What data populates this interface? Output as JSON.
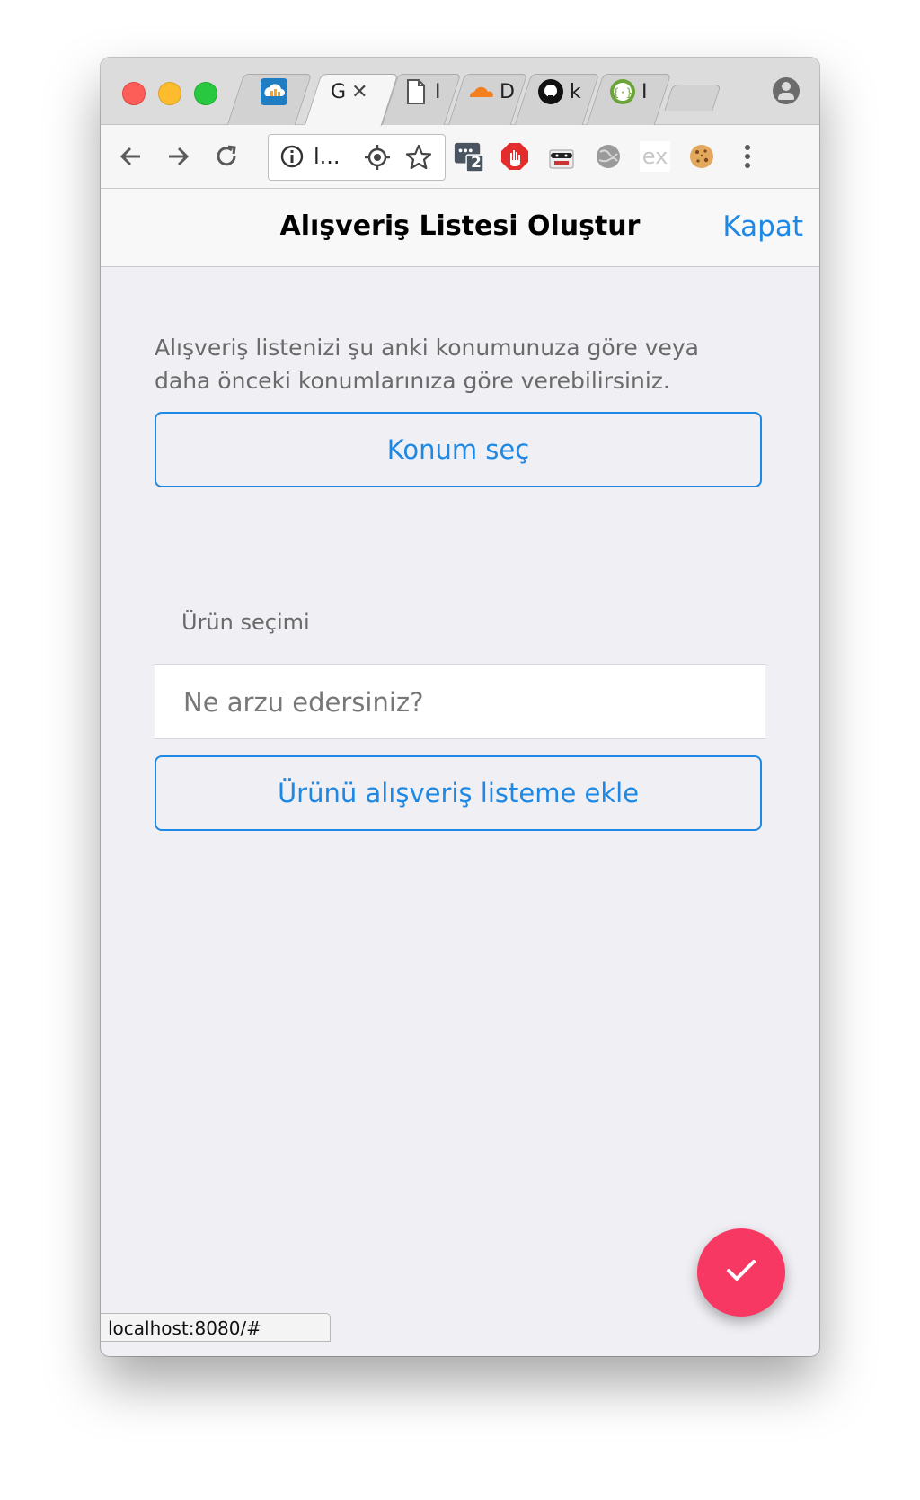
{
  "browser": {
    "active_tab_label": "G",
    "tabs": [
      {
        "label": "",
        "icon": "cloud-chart-icon"
      },
      {
        "label": "G",
        "icon": "",
        "active": true
      },
      {
        "label": "I",
        "icon": "document-icon"
      },
      {
        "label": "D",
        "icon": "cloudflare-icon"
      },
      {
        "label": "k",
        "icon": "github-icon"
      },
      {
        "label": "I",
        "icon": "json-icon"
      }
    ],
    "omnibox_text": "l...",
    "extension_badge": "2",
    "ex_label": "ex",
    "status_url": "localhost:8080/#"
  },
  "navbar": {
    "title": "Alışveriş Listesi Oluştur",
    "close_label": "Kapat"
  },
  "main": {
    "intro_text": "Alışveriş listenizi şu anki konumunuza göre veya daha önceki konumlarınıza göre verebilirsiniz.",
    "location_button": "Konum seç",
    "product_label": "Ürün seçimi",
    "product_placeholder": "Ne arzu edersiniz?",
    "add_button": "Ürünü alışveriş listeme ekle"
  },
  "fab": {
    "icon": "checkmark-icon"
  },
  "colors": {
    "accent": "#1e88e5",
    "fab": "#f73862",
    "background": "#efeff4"
  }
}
